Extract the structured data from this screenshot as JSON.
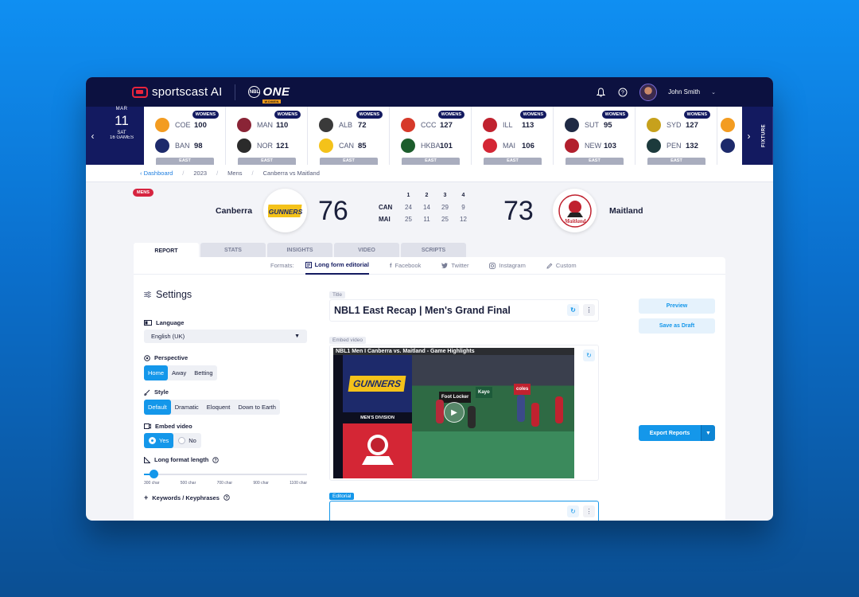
{
  "topbar": {
    "brand": "sportscast AI",
    "league_logo": "ONE",
    "user_name": "John Smith",
    "icons": [
      "bell-icon",
      "help-icon"
    ]
  },
  "fixtures": {
    "date": {
      "month": "MAR",
      "day": "11",
      "weekday": "SAT",
      "games": "16 GAMES"
    },
    "fixture_tab": "FIXTURE",
    "games": [
      {
        "badge": "WOMENS",
        "home": "COE",
        "home_score": "100",
        "away": "BAN",
        "away_score": "98",
        "conf": "EAST",
        "home_color": "#f39c21",
        "away_color": "#1d2a6b"
      },
      {
        "badge": "WOMENS",
        "home": "MAN",
        "home_score": "110",
        "away": "NOR",
        "away_score": "121",
        "conf": "EAST",
        "home_color": "#8a2436",
        "away_color": "#2b2b2b"
      },
      {
        "badge": "WOMENS",
        "home": "ALB",
        "home_score": "72",
        "away": "CAN",
        "away_score": "85",
        "conf": "EAST",
        "home_color": "#3a3a3a",
        "away_color": "#f4c21a"
      },
      {
        "badge": "WOMENS",
        "home": "CCC",
        "home_score": "127",
        "away": "HKBA",
        "away_score": "101",
        "conf": "EAST",
        "home_color": "#d63a2a",
        "away_color": "#1c5d2c"
      },
      {
        "badge": "WOMENS",
        "home": "ILL",
        "home_score": "113",
        "away": "MAI",
        "away_score": "106",
        "conf": "EAST",
        "home_color": "#c0222f",
        "away_color": "#d42635"
      },
      {
        "badge": "WOMENS",
        "home": "SUT",
        "home_score": "95",
        "away": "NEW",
        "away_score": "103",
        "conf": "EAST",
        "home_color": "#1f2a44",
        "away_color": "#b21f2d"
      },
      {
        "badge": "WOMENS",
        "home": "SYD",
        "home_score": "127",
        "away": "PEN",
        "away_score": "132",
        "conf": "EAST",
        "home_color": "#c7a11c",
        "away_color": "#1c3a3c"
      }
    ]
  },
  "breadcrumb": {
    "back": "Dashboard",
    "items": [
      "2023",
      "Mens",
      "Canberra vs Maitland"
    ]
  },
  "match": {
    "badge": "MENS",
    "home_name": "Canberra",
    "home_score": "76",
    "away_name": "Maitland",
    "away_score": "73",
    "home_logo_text": "GUNNERS",
    "away_logo_text": "Maitland",
    "quarters_header": [
      "1",
      "2",
      "3",
      "4"
    ],
    "rows": [
      {
        "team": "CAN",
        "q": [
          "24",
          "14",
          "29",
          "9"
        ]
      },
      {
        "team": "MAI",
        "q": [
          "25",
          "11",
          "25",
          "12"
        ]
      }
    ]
  },
  "tabs": [
    "REPORT",
    "STATS",
    "INSIGHTS",
    "VIDEO",
    "SCRIPTS"
  ],
  "formats": {
    "label": "Formats:",
    "items": [
      "Long form editorial",
      "Facebook",
      "Twitter",
      "Instagram",
      "Custom"
    ]
  },
  "settings": {
    "title": "Settings",
    "language_label": "Language",
    "language_value": "English (UK)",
    "perspective_label": "Perspective",
    "perspective_options": [
      "Home",
      "Away",
      "Betting"
    ],
    "style_label": "Style",
    "style_options": [
      "Default",
      "Dramatic",
      "Eloquent",
      "Down to Earth"
    ],
    "embed_label": "Embed video",
    "embed_yes": "Yes",
    "embed_no": "No",
    "length_label": "Long format length",
    "length_value": 0.06,
    "length_ticks": [
      "300 char",
      "500 char",
      "700 char",
      "900 char",
      "1100 char"
    ],
    "keywords_label": "Keywords / Keyphrases"
  },
  "editor": {
    "title_tag": "Title",
    "title_value": "NBL1 East Recap | Men's Grand Final",
    "embed_tag": "Embed video",
    "video_title": "NBL1 Men I Canberra vs. Maitland - Game Highlights",
    "video_left_label": "MEN'S DIVISION",
    "video_logo_top": "GUNNERS",
    "video_ads": [
      "Foot Locker",
      "Kayo",
      "coles"
    ],
    "editorial_tag": "Editorial"
  },
  "actions": {
    "preview": "Preview",
    "save_draft": "Save as Draft",
    "export": "Export Reports"
  },
  "colors": {
    "navy": "#0c1140",
    "accent": "#1497ea",
    "mens_badge": "#d62440"
  }
}
